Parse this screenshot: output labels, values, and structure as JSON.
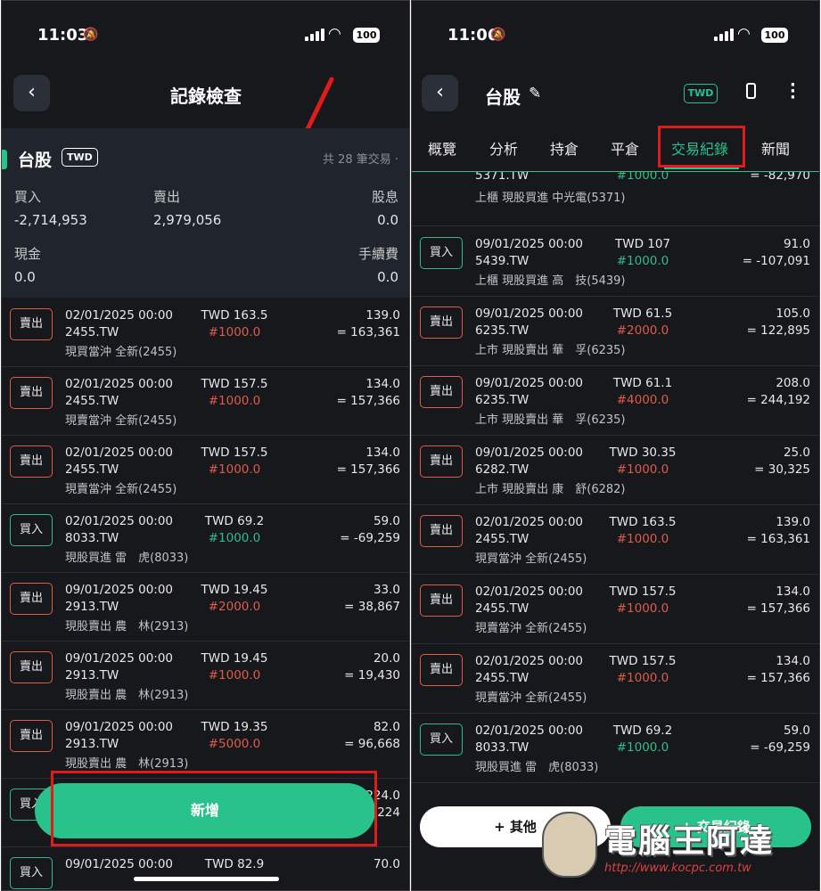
{
  "left": {
    "status": {
      "time": "11:03",
      "battery": "100"
    },
    "title": "記錄檢查",
    "summary": {
      "name": "台股",
      "currency": "TWD",
      "count": "共 28 筆交易 ·",
      "buy_label": "買入",
      "buy_value": "-2,714,953",
      "sell_label": "賣出",
      "sell_value": "2,979,056",
      "dividend_label": "股息",
      "dividend_value": "0.0",
      "cash_label": "現金",
      "cash_value": "0.0",
      "fee_label": "手續費",
      "fee_value": "0.0"
    },
    "rows": [
      {
        "type": "賣出",
        "kind": "sell",
        "date": "02/01/2025 00:00",
        "code": "2455.TW",
        "desc": "現買當沖 全新(2455)",
        "price": "TWD 163.5",
        "qty": "#1000.0",
        "fee": "139.0",
        "total": "= 163,361"
      },
      {
        "type": "賣出",
        "kind": "sell",
        "date": "02/01/2025 00:00",
        "code": "2455.TW",
        "desc": "現賣當沖 全新(2455)",
        "price": "TWD 157.5",
        "qty": "#1000.0",
        "fee": "134.0",
        "total": "= 157,366"
      },
      {
        "type": "賣出",
        "kind": "sell",
        "date": "02/01/2025 00:00",
        "code": "2455.TW",
        "desc": "現賣當沖 全新(2455)",
        "price": "TWD 157.5",
        "qty": "#1000.0",
        "fee": "134.0",
        "total": "= 157,366"
      },
      {
        "type": "買入",
        "kind": "buy",
        "date": "02/01/2025 00:00",
        "code": "8033.TW",
        "desc": "現股買進 雷　虎(8033)",
        "price": "TWD 69.2",
        "qty": "#1000.0",
        "fee": "59.0",
        "total": "= -69,259"
      },
      {
        "type": "賣出",
        "kind": "sell",
        "date": "09/01/2025 00:00",
        "code": "2913.TW",
        "desc": "現股賣出 農　林(2913)",
        "price": "TWD 19.45",
        "qty": "#2000.0",
        "fee": "33.0",
        "total": "= 38,867"
      },
      {
        "type": "賣出",
        "kind": "sell",
        "date": "09/01/2025 00:00",
        "code": "2913.TW",
        "desc": "現股賣出 農　林(2913)",
        "price": "TWD 19.45",
        "qty": "#1000.0",
        "fee": "20.0",
        "total": "= 19,430"
      },
      {
        "type": "賣出",
        "kind": "sell",
        "date": "09/01/2025 00:00",
        "code": "2913.TW",
        "desc": "現股賣出 農　林(2913)",
        "price": "TWD 19.35",
        "qty": "#5000.0",
        "fee": "82.0",
        "total": "= 96,668"
      },
      {
        "type": "買入",
        "kind": "buy",
        "date": "",
        "code": "",
        "desc": "",
        "price": "",
        "qty": "",
        "fee": "224.0",
        "total": "224"
      },
      {
        "type": "買入",
        "kind": "buy",
        "date": "09/01/2025 00:00",
        "code": "",
        "desc": "",
        "price": "TWD 82.9",
        "qty": "",
        "fee": "70.0",
        "total": ""
      }
    ],
    "add_button": "新增"
  },
  "right": {
    "status": {
      "time": "11:06",
      "battery": "100"
    },
    "title": "台股",
    "currency_chip": "TWD",
    "tabs": [
      "概覽",
      "分析",
      "持倉",
      "平倉",
      "交易紀錄",
      "新聞"
    ],
    "active_tab": "交易紀錄",
    "partial_row": {
      "code": "5371.TW",
      "qty": "#1000.0",
      "total": "= -82,970",
      "desc": "上櫃 現股買進 中光電(5371)"
    },
    "rows": [
      {
        "type": "買入",
        "kind": "buy",
        "date": "09/01/2025 00:00",
        "code": "5439.TW",
        "desc": "上櫃 現股買進 高　技(5439)",
        "price": "TWD 107",
        "qty": "#1000.0",
        "fee": "91.0",
        "total": "= -107,091"
      },
      {
        "type": "賣出",
        "kind": "sell",
        "date": "09/01/2025 00:00",
        "code": "6235.TW",
        "desc": "上市 現股賣出 華　孚(6235)",
        "price": "TWD 61.5",
        "qty": "#2000.0",
        "fee": "105.0",
        "total": "= 122,895"
      },
      {
        "type": "賣出",
        "kind": "sell",
        "date": "09/01/2025 00:00",
        "code": "6235.TW",
        "desc": "上市 現股賣出 華　孚(6235)",
        "price": "TWD 61.1",
        "qty": "#4000.0",
        "fee": "208.0",
        "total": "= 244,192"
      },
      {
        "type": "賣出",
        "kind": "sell",
        "date": "09/01/2025 00:00",
        "code": "6282.TW",
        "desc": "上市 現股賣出 康　舒(6282)",
        "price": "TWD 30.35",
        "qty": "#1000.0",
        "fee": "25.0",
        "total": "= 30,325"
      },
      {
        "type": "賣出",
        "kind": "sell",
        "date": "02/01/2025 00:00",
        "code": "2455.TW",
        "desc": "現買當沖 全新(2455)",
        "price": "TWD 163.5",
        "qty": "#1000.0",
        "fee": "139.0",
        "total": "= 163,361"
      },
      {
        "type": "賣出",
        "kind": "sell",
        "date": "02/01/2025 00:00",
        "code": "2455.TW",
        "desc": "現賣當沖 全新(2455)",
        "price": "TWD 157.5",
        "qty": "#1000.0",
        "fee": "134.0",
        "total": "= 157,366"
      },
      {
        "type": "賣出",
        "kind": "sell",
        "date": "02/01/2025 00:00",
        "code": "2455.TW",
        "desc": "現賣當沖 全新(2455)",
        "price": "TWD 157.5",
        "qty": "#1000.0",
        "fee": "134.0",
        "total": "= 157,366"
      },
      {
        "type": "買入",
        "kind": "buy",
        "date": "02/01/2025 00:00",
        "code": "8033.TW",
        "desc": "現股買進 雷　虎(8033)",
        "price": "TWD 69.2",
        "qty": "#1000.0",
        "fee": "59.0",
        "total": "= -69,259"
      }
    ],
    "other_button": "+ 其他",
    "trade_button": "+ 交易紀錄"
  },
  "watermark": {
    "text": "電腦王阿達",
    "url": "http://www.kocpc.com.tw"
  }
}
